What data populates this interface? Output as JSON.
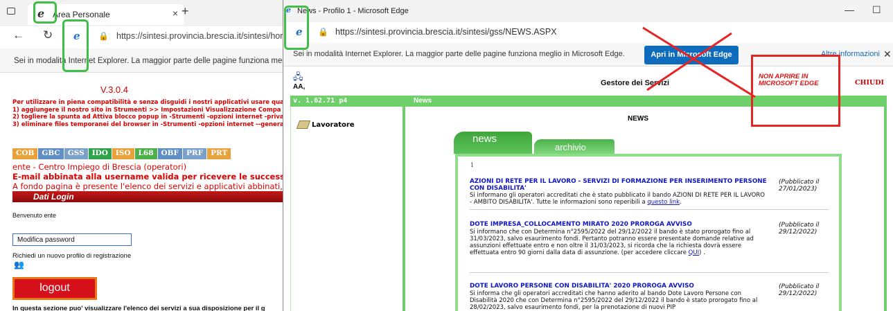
{
  "back_window": {
    "tab_title": "Area Personale",
    "new_tab": "+",
    "url": "https://sintesi.provincia.brescia.it/sintesi/hom",
    "ie_infobar": "Sei in modalità Internet Explorer. La maggior parte delle pagine funziona meglio",
    "version": "V.3.0.4",
    "warning_lines": [
      "Per utilizzare in piena compatibilità e senza disguidi i nostri applicativi usare qua",
      "1) aggiungere il nostro sito in Strumenti >> Impostazioni Visualizzazione Compa",
      "2) togliere la spunta ad Attiva blocco popup in -Strumenti -opzioni internet -priva",
      "3) eliminare files temporanei del browser in -Strumenti -opzioni internet --genera"
    ],
    "app_buttons": [
      "COB",
      "GBC",
      "GSS",
      "IDO",
      "ISO",
      "L68",
      "OBF",
      "PRF",
      "PRT"
    ],
    "centro_impiego": "ente - Centro Impiego di Brescia (operatori)",
    "email_notice": "E-mail abbinata alla username valida per ricevere le successiv",
    "fondo_pagina": "A fondo pagina è presente l'elenco dei servizi e applicativi abbinati, pe",
    "dati_login": "Dati Login",
    "benvenuto": "Benvenuto ente",
    "modifica_password": "Modifica password",
    "richiedi_profilo": "Richiedi un nuovo profilo di registrazione",
    "logout": "logout",
    "bottom_text": "In questa sezione puo' visualizzare l'elenco dei servizi a sua disposizione per il g"
  },
  "front_window": {
    "title": "News - Profilo 1 - Microsoft Edge",
    "url": "https://sintesi.provincia.brescia.it/sintesi/gss/NEWS.ASPX",
    "ie_infobar": "Sei in modalità Internet Explorer. La maggior parte delle pagine funziona meglio in Microsoft Edge.",
    "apri_button": "Apri in Microsoft Edge",
    "altre_info": "Altre informazioni",
    "app_logo_text": "AA,",
    "gestore": "Gestore dei Servizi",
    "non_aprire": "NON APRIRE IN MICROSOFT EDGE",
    "chiudi": "CHIUDI",
    "version": "v. 1.62.71 p4",
    "section": "News",
    "lavoratore": "Lavoratore",
    "news_heading": "NEWS",
    "tab_news": "news",
    "tab_archivio": "archivio",
    "page_number": "1",
    "news": [
      {
        "title": "AZIONI DI RETE PER IL LAVORO - SERVIZI DI FORMAZIONE PER INSERIMENTO PERSONE CON DISABILITA'",
        "body": "Si informano gli operatori accreditati che è stato pubblicato il bando AZIONI DI RETE PER IL LAVORO - AMBITO DISABILITA'. Tutte le informazioni sono reperibili a",
        "link": "questo link",
        "body_after": ".",
        "date": "(Pubblicato il 27/01/2023)"
      },
      {
        "title": "DOTE IMPRESA_COLLOCAMENTO MIRATO 2020 PROROGA AVVISO",
        "body": "Si informano che con Determina n°2595/2022 del 29/12/2022 il bando è stato prorogato fino al 31/03/2023, salvo esaurimento fondi. Pertanto potranno essere presentate domande relative ad assunzioni effettuate entro e non oltre il 31/03/2023, si ricorda che la richiesta dovrà essere effettuata entro 90 giorni dalla data di assunzione. (per accedere cliccare",
        "link": "QUI",
        "body_after": ") .",
        "date": "(Pubblicato il 29/12/2022)"
      },
      {
        "title": "DOTE LAVORO PERSONE CON DISABILITA' 2020 PROROGA AVVISO",
        "body": "Si informa che gli operatori accreditati che hanno aderito al bando Dote Lavoro Persone con Disabilità 2020 che con Determina n°2595/2022 del 29/12/2022 il bando è stato prorogato fino al 28/02/2023, salvo esaurimento fondi, per la prenotazione di nuovi PIP",
        "link": "",
        "body_after": "",
        "date": "(Pubblicato il 29/12/2022)"
      }
    ]
  },
  "icons": [
    "tab-actions-icon",
    "ie-logo-icon",
    "back-arrow-icon",
    "refresh-icon",
    "lock-icon",
    "close-icon",
    "minimize-icon",
    "maximize-icon",
    "book-icon",
    "people-icon"
  ],
  "colors": {
    "accent_green": "#6fcf6a",
    "edge_blue": "#0f6cbd",
    "warning_red": "#d00",
    "annotation_green": "#3fbf48",
    "annotation_red": "#e52424"
  }
}
